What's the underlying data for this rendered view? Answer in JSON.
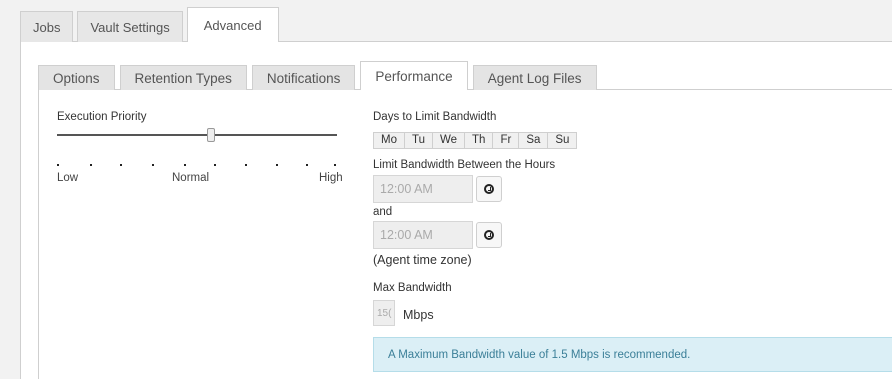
{
  "outer_tabs": [
    {
      "label": "Jobs",
      "active": false
    },
    {
      "label": "Vault Settings",
      "active": false
    },
    {
      "label": "Advanced",
      "active": true
    }
  ],
  "inner_tabs": [
    {
      "label": "Options",
      "active": false
    },
    {
      "label": "Retention Types",
      "active": false
    },
    {
      "label": "Notifications",
      "active": false
    },
    {
      "label": "Performance",
      "active": true
    },
    {
      "label": "Agent Log Files",
      "active": false
    }
  ],
  "execution_priority": {
    "label": "Execution Priority",
    "scale_low": "Low",
    "scale_normal": "Normal",
    "scale_high": "High",
    "level_fraction": 0.55
  },
  "bandwidth": {
    "days_label": "Days to Limit Bandwidth",
    "days": [
      "Mo",
      "Tu",
      "We",
      "Th",
      "Fr",
      "Sa",
      "Su"
    ],
    "hours_label": "Limit Bandwidth Between the Hours",
    "start_time": "12:00 AM",
    "and_label": "and",
    "end_time": "12:00 AM",
    "timezone_note": "(Agent time zone)",
    "max_label": "Max Bandwidth",
    "max_value": "15(",
    "unit": "Mbps",
    "info_message": "A Maximum Bandwidth value of 1.5 Mbps is recommended."
  },
  "colors": {
    "info_bg": "#dbeff6",
    "info_text": "#3b7f98"
  }
}
